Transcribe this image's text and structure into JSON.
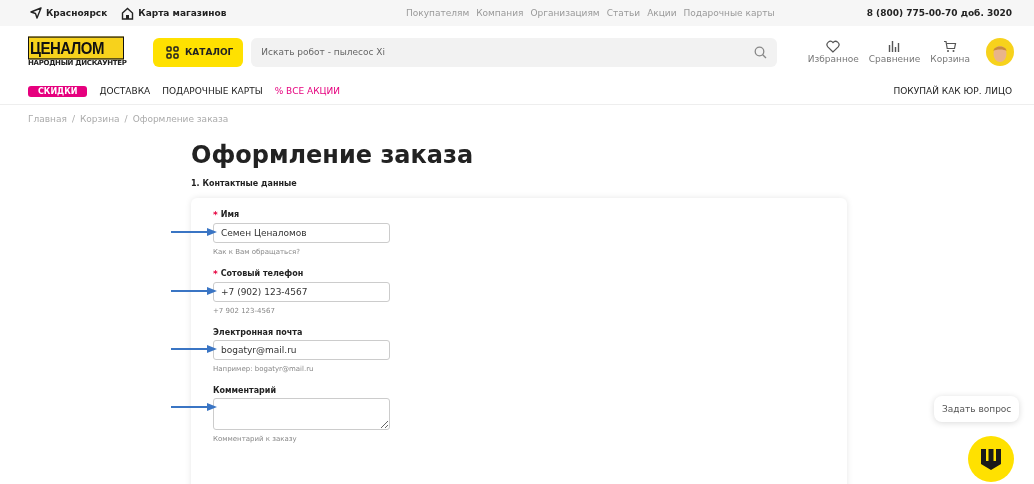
{
  "topbar": {
    "city": "Красноярск",
    "stores": "Карта магазинов",
    "links": [
      "Покупателям",
      "Компания",
      "Организациям",
      "Статьи",
      "Акции",
      "Подарочные карты"
    ],
    "phone": "8 (800) 775-00-70 доб. 3020"
  },
  "header": {
    "logo": "ЦЕНАЛОМ",
    "logo_tagline": "НАРОДНЫЙ ДИСКАУНТЕР",
    "catalog": "КАТАЛОГ",
    "search": {
      "placeholder": "Искать робот - пылесос Xi"
    },
    "actions": [
      {
        "kind": "heart",
        "label": "Избранное"
      },
      {
        "kind": "bars",
        "label": "Сравнение"
      },
      {
        "kind": "cart",
        "label": "Корзина"
      }
    ]
  },
  "nav": {
    "items": [
      {
        "label": "СКИДКИ",
        "kind": "badge"
      },
      {
        "label": "ДОСТАВКА",
        "kind": "plain"
      },
      {
        "label": "ПОДАРОЧНЫЕ КАРТЫ",
        "kind": "plain"
      },
      {
        "label": "% ВСЕ АКЦИИ",
        "kind": "accent"
      }
    ],
    "right": "ПОКУПАЙ КАК ЮР. ЛИЦО"
  },
  "breadcrumbs": [
    "Главная",
    "Корзина",
    "Оформление заказа"
  ],
  "breadcrumb_separator": "/",
  "required_symbol": "*",
  "title": "Оформление заказа",
  "section": "1. Контактные данные",
  "fields": [
    {
      "kind": "input",
      "label": "Имя",
      "required": true,
      "value": "Семен Ценаломов",
      "hint": "Как к Вам обращаться?",
      "arrow": true
    },
    {
      "kind": "input",
      "label": "Сотовый телефон",
      "required": true,
      "value": "+7 (902) 123-4567",
      "hint": "+7 902 123-4567",
      "arrow": true
    },
    {
      "kind": "input",
      "label": "Электронная почта",
      "required": false,
      "value": "bogatyr@mail.ru",
      "hint": "Например: bogatyr@mail.ru",
      "arrow": true
    },
    {
      "kind": "textarea",
      "label": "Комментарий",
      "required": false,
      "hint": "Комментарий к заказу",
      "arrow": true
    }
  ],
  "chat": {
    "tooltip": "Задать вопрос"
  }
}
